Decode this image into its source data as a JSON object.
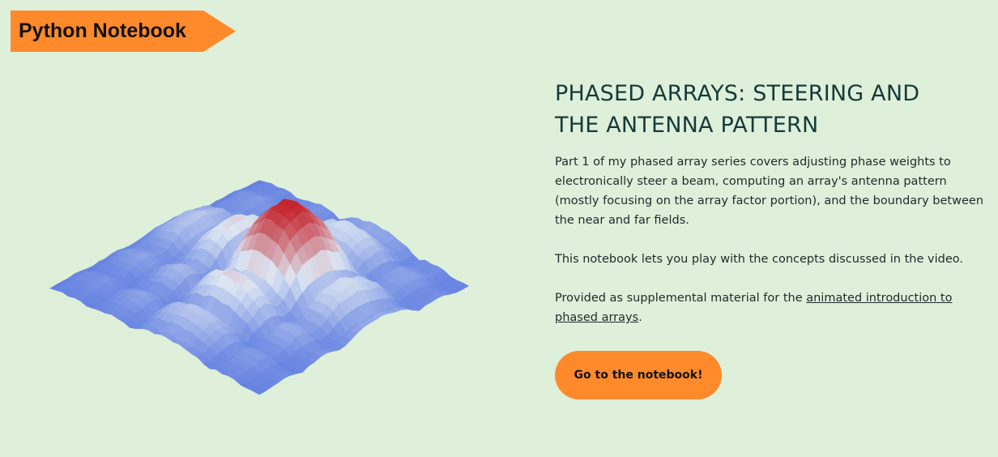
{
  "banner": {
    "label": "Python Notebook",
    "color": "#ff8a2b"
  },
  "visual": {
    "description_icon": "antenna-pattern-surface-plot",
    "colors": {
      "low": "#5b7ae0",
      "mid": "#dde6f2",
      "high": "#c4262e"
    }
  },
  "article": {
    "title_line1": "PHASED ARRAYS: STEERING AND",
    "title_line2": "THE ANTENNA PATTERN",
    "para1": "Part 1 of my phased array series covers adjusting phase weights to electronically steer a beam, computing an array's antenna pattern (mostly focusing on the array factor portion), and the boundary between the near and far fields.",
    "para2": "This notebook lets you play with the concepts discussed in the video.",
    "para3_prefix": "Provided as supplemental material for the ",
    "para3_link": "animated introduction to phased arrays",
    "para3_suffix": "."
  },
  "cta": {
    "label": "Go to the notebook!",
    "color": "#ff8a2b"
  }
}
